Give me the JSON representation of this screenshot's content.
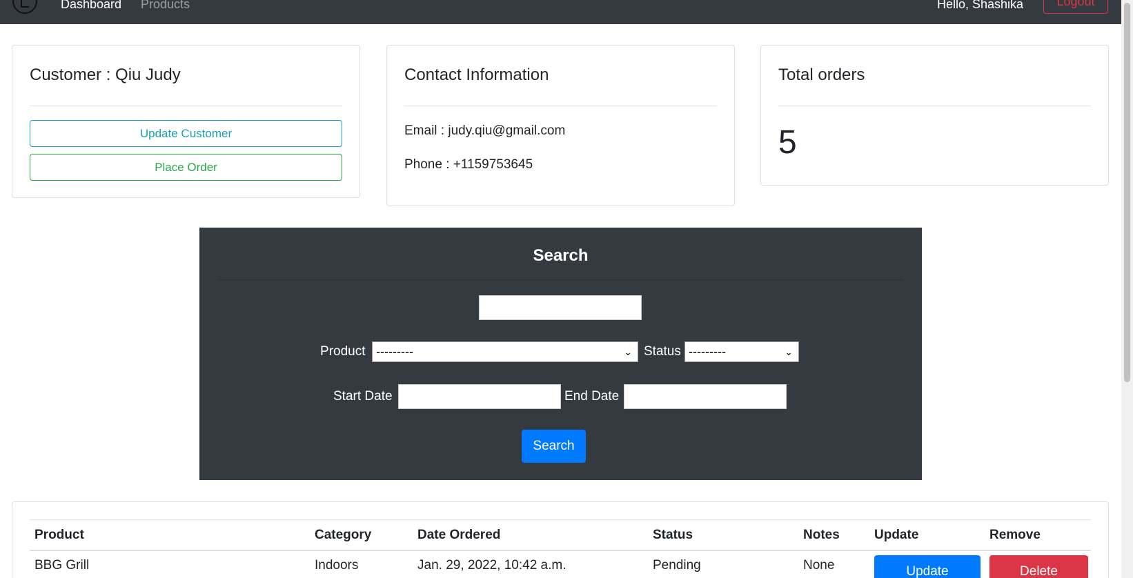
{
  "navbar": {
    "links": [
      "Dashboard",
      "Products"
    ],
    "greeting": "Hello, Shashika",
    "logout_label": "Logout"
  },
  "customer_card": {
    "title": "Customer : Qiu Judy",
    "update_label": "Update Customer",
    "place_order_label": "Place Order"
  },
  "contact_card": {
    "title": "Contact Information",
    "email": "Email : judy.qiu@gmail.com",
    "phone": "Phone : +1159753645"
  },
  "orders_card": {
    "title": "Total orders",
    "total": "5"
  },
  "search": {
    "heading": "Search",
    "query_value": "",
    "product_label": "Product",
    "product_selected": "---------",
    "status_label": "Status",
    "status_selected": "---------",
    "start_date_label": "Start Date",
    "end_date_label": "End Date",
    "button_label": "Search"
  },
  "table": {
    "headers": [
      "Product",
      "Category",
      "Date Ordered",
      "Status",
      "Notes",
      "Update",
      "Remove"
    ],
    "rows": [
      {
        "product": "BBG Grill",
        "category": "Indoors",
        "date_ordered": "Jan. 29, 2022, 10:42 a.m.",
        "status": "Pending",
        "notes": "None",
        "update_label": "Update",
        "delete_label": "Delete"
      }
    ]
  },
  "colors": {
    "navbar": "#343a40",
    "primary": "#007bff",
    "danger": "#dc3545",
    "info": "#17a2b8",
    "success": "#28a745"
  },
  "icons": {
    "logo": "logo-icon",
    "select_arrow": "chevron-down-icon"
  }
}
